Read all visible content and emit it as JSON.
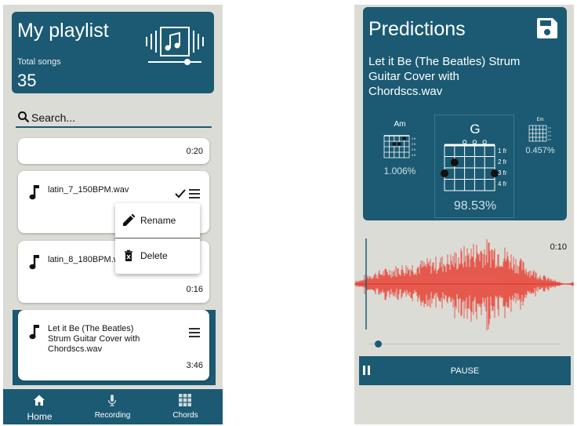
{
  "playlist": {
    "title": "My playlist",
    "subtitle": "Total songs",
    "count": "35",
    "search_placeholder": "Search...",
    "songs": [
      {
        "name": "",
        "duration": "0:20"
      },
      {
        "name": "latin_7_150BPM.wav",
        "duration": ""
      },
      {
        "name": "latin_8_180BPM.wav",
        "duration": "0:16"
      },
      {
        "name": "Let it Be (The Beatles) Strum Guitar Cover with Chordscs.wav",
        "duration": "3:46"
      }
    ],
    "context_menu": {
      "rename": "Rename",
      "delete": "Delete"
    },
    "nav": [
      {
        "label": "Home",
        "icon": "home-icon"
      },
      {
        "label": "Recording",
        "icon": "microphone-icon"
      },
      {
        "label": "Chords",
        "icon": "grid-icon"
      }
    ]
  },
  "predictions": {
    "title": "Predictions",
    "song": "Let it Be (The Beatles) Strum Guitar Cover with Chordscs.wav",
    "chords": [
      {
        "name": "Am",
        "percent": "1.006%"
      },
      {
        "name": "G",
        "percent": "98.53%"
      },
      {
        "name": "Em",
        "percent": "0.457%"
      }
    ],
    "fret_labels": [
      "1 fr",
      "2 fr",
      "3 fr",
      "4 fr"
    ],
    "time": "0:10",
    "pause_label": "PAUSE"
  },
  "colors": {
    "accent": "#1b5a72",
    "wave": "#e8392b",
    "background": "#dcdcd6"
  }
}
